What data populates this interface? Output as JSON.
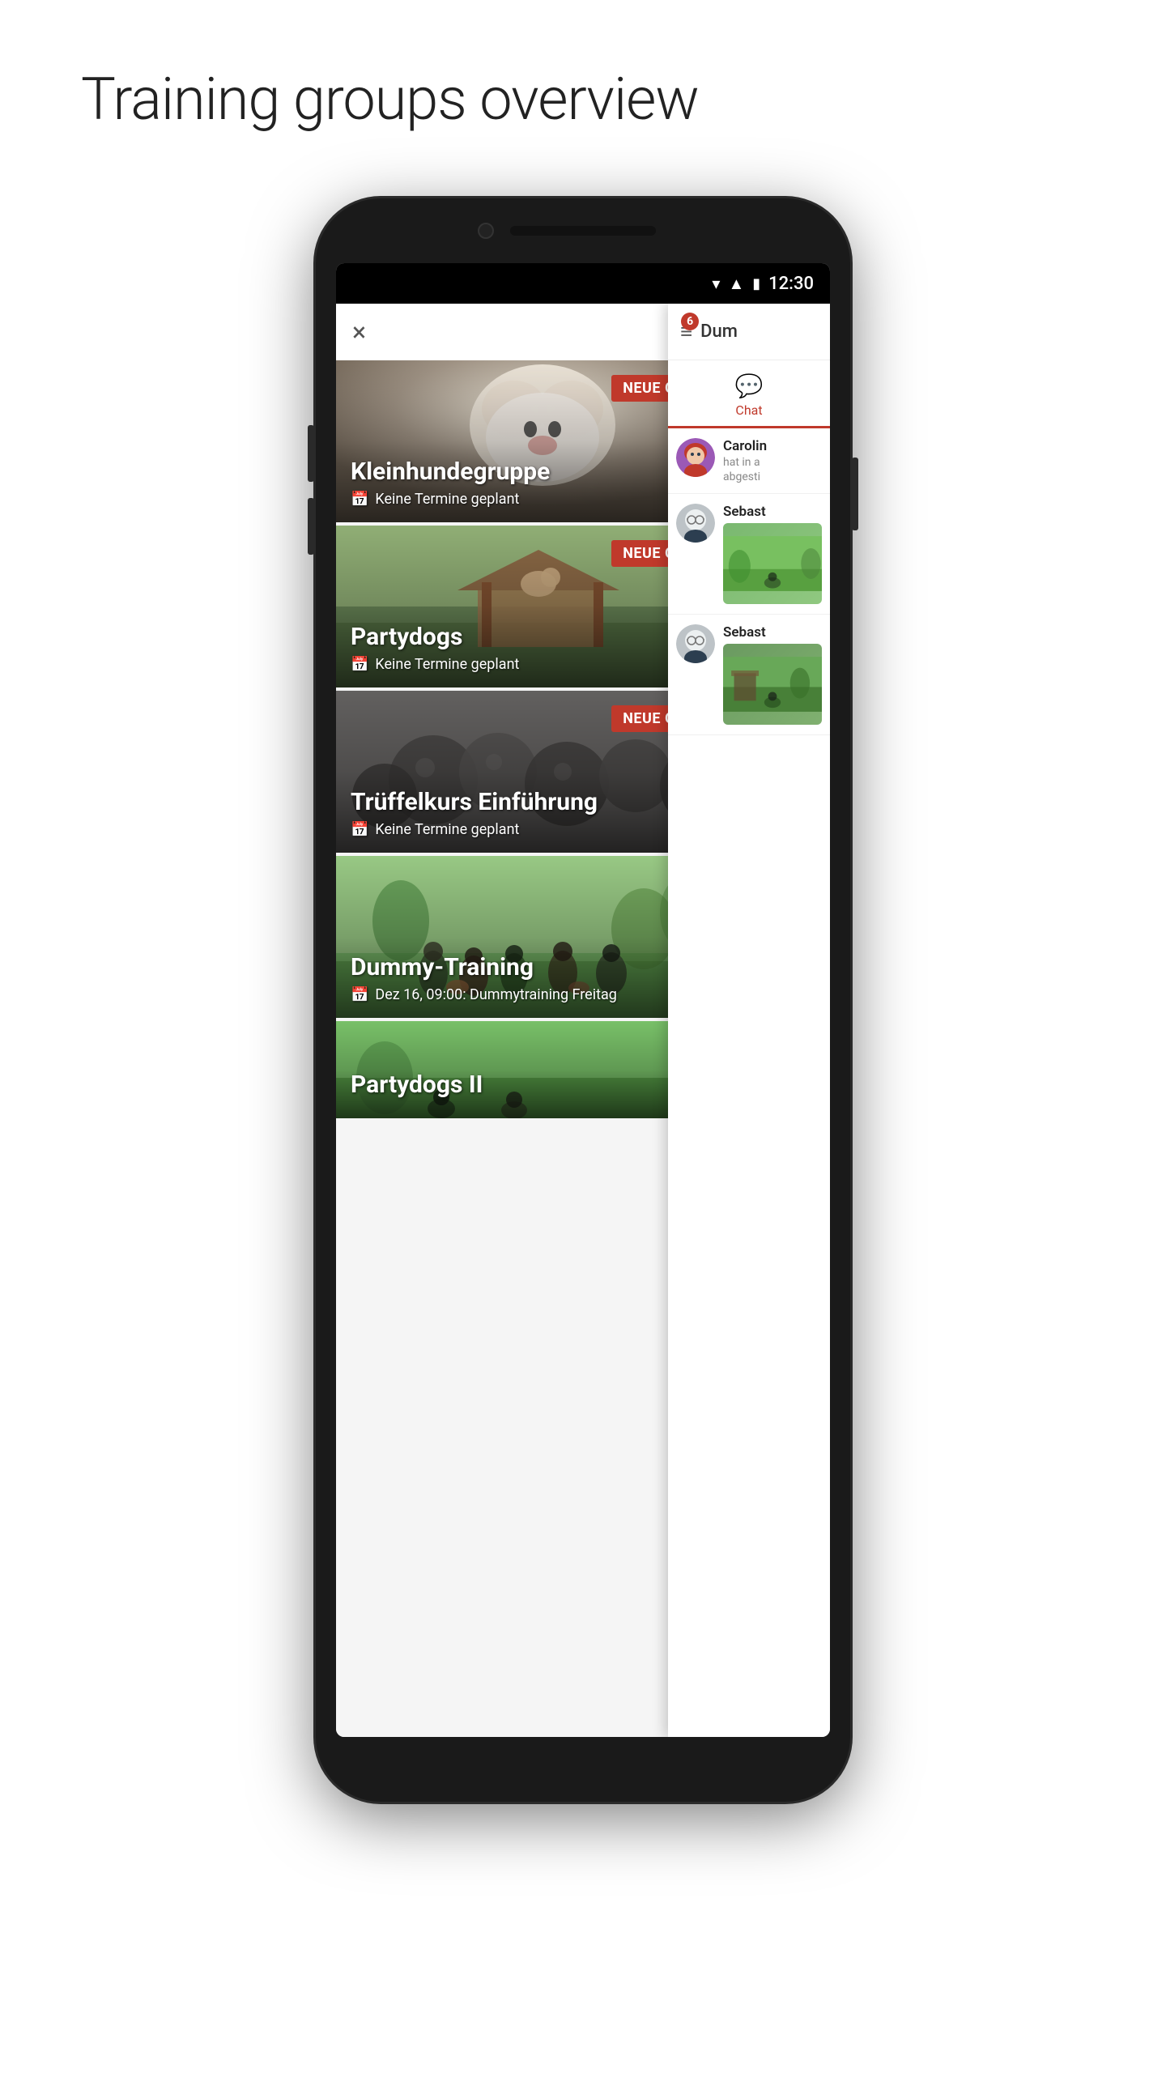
{
  "page": {
    "title": "Training groups overview"
  },
  "status_bar": {
    "time": "12:30",
    "wifi_icon": "wifi",
    "signal_icon": "signal",
    "battery_icon": "battery"
  },
  "top_bar": {
    "close_icon": "×"
  },
  "right_panel": {
    "notification_count": "6",
    "header_title": "Dum",
    "chat_tab_label": "Chat",
    "users": [
      {
        "name": "Carolin",
        "preview_line1": "hat in a",
        "preview_line2": "abgesti"
      },
      {
        "name": "Sebast",
        "preview": ""
      },
      {
        "name": "Sebast",
        "preview": ""
      }
    ]
  },
  "groups": [
    {
      "id": "kleinhundegruppe",
      "title": "Kleinhundegruppe",
      "badge": "NEUE GRUPPE",
      "date_text": "Keine Termine geplant",
      "has_trophy": false
    },
    {
      "id": "partydogs",
      "title": "Partydogs",
      "badge": "NEUE GRUPPE",
      "date_text": "Keine Termine geplant",
      "has_trophy": false
    },
    {
      "id": "trueffelkurs",
      "title": "Trüffelkurs Einführung",
      "badge": "NEUE GRUPPE",
      "date_text": "Keine Termine geplant",
      "has_trophy": false
    },
    {
      "id": "dummy-training",
      "title": "Dummy-Training",
      "badge": "",
      "date_text": "Dez 16, 09:00: Dummytraining Freitag",
      "has_trophy": true
    },
    {
      "id": "partydogs-2",
      "title": "Partydogs II",
      "badge": "",
      "date_text": "",
      "has_trophy": false,
      "partial": true
    }
  ]
}
